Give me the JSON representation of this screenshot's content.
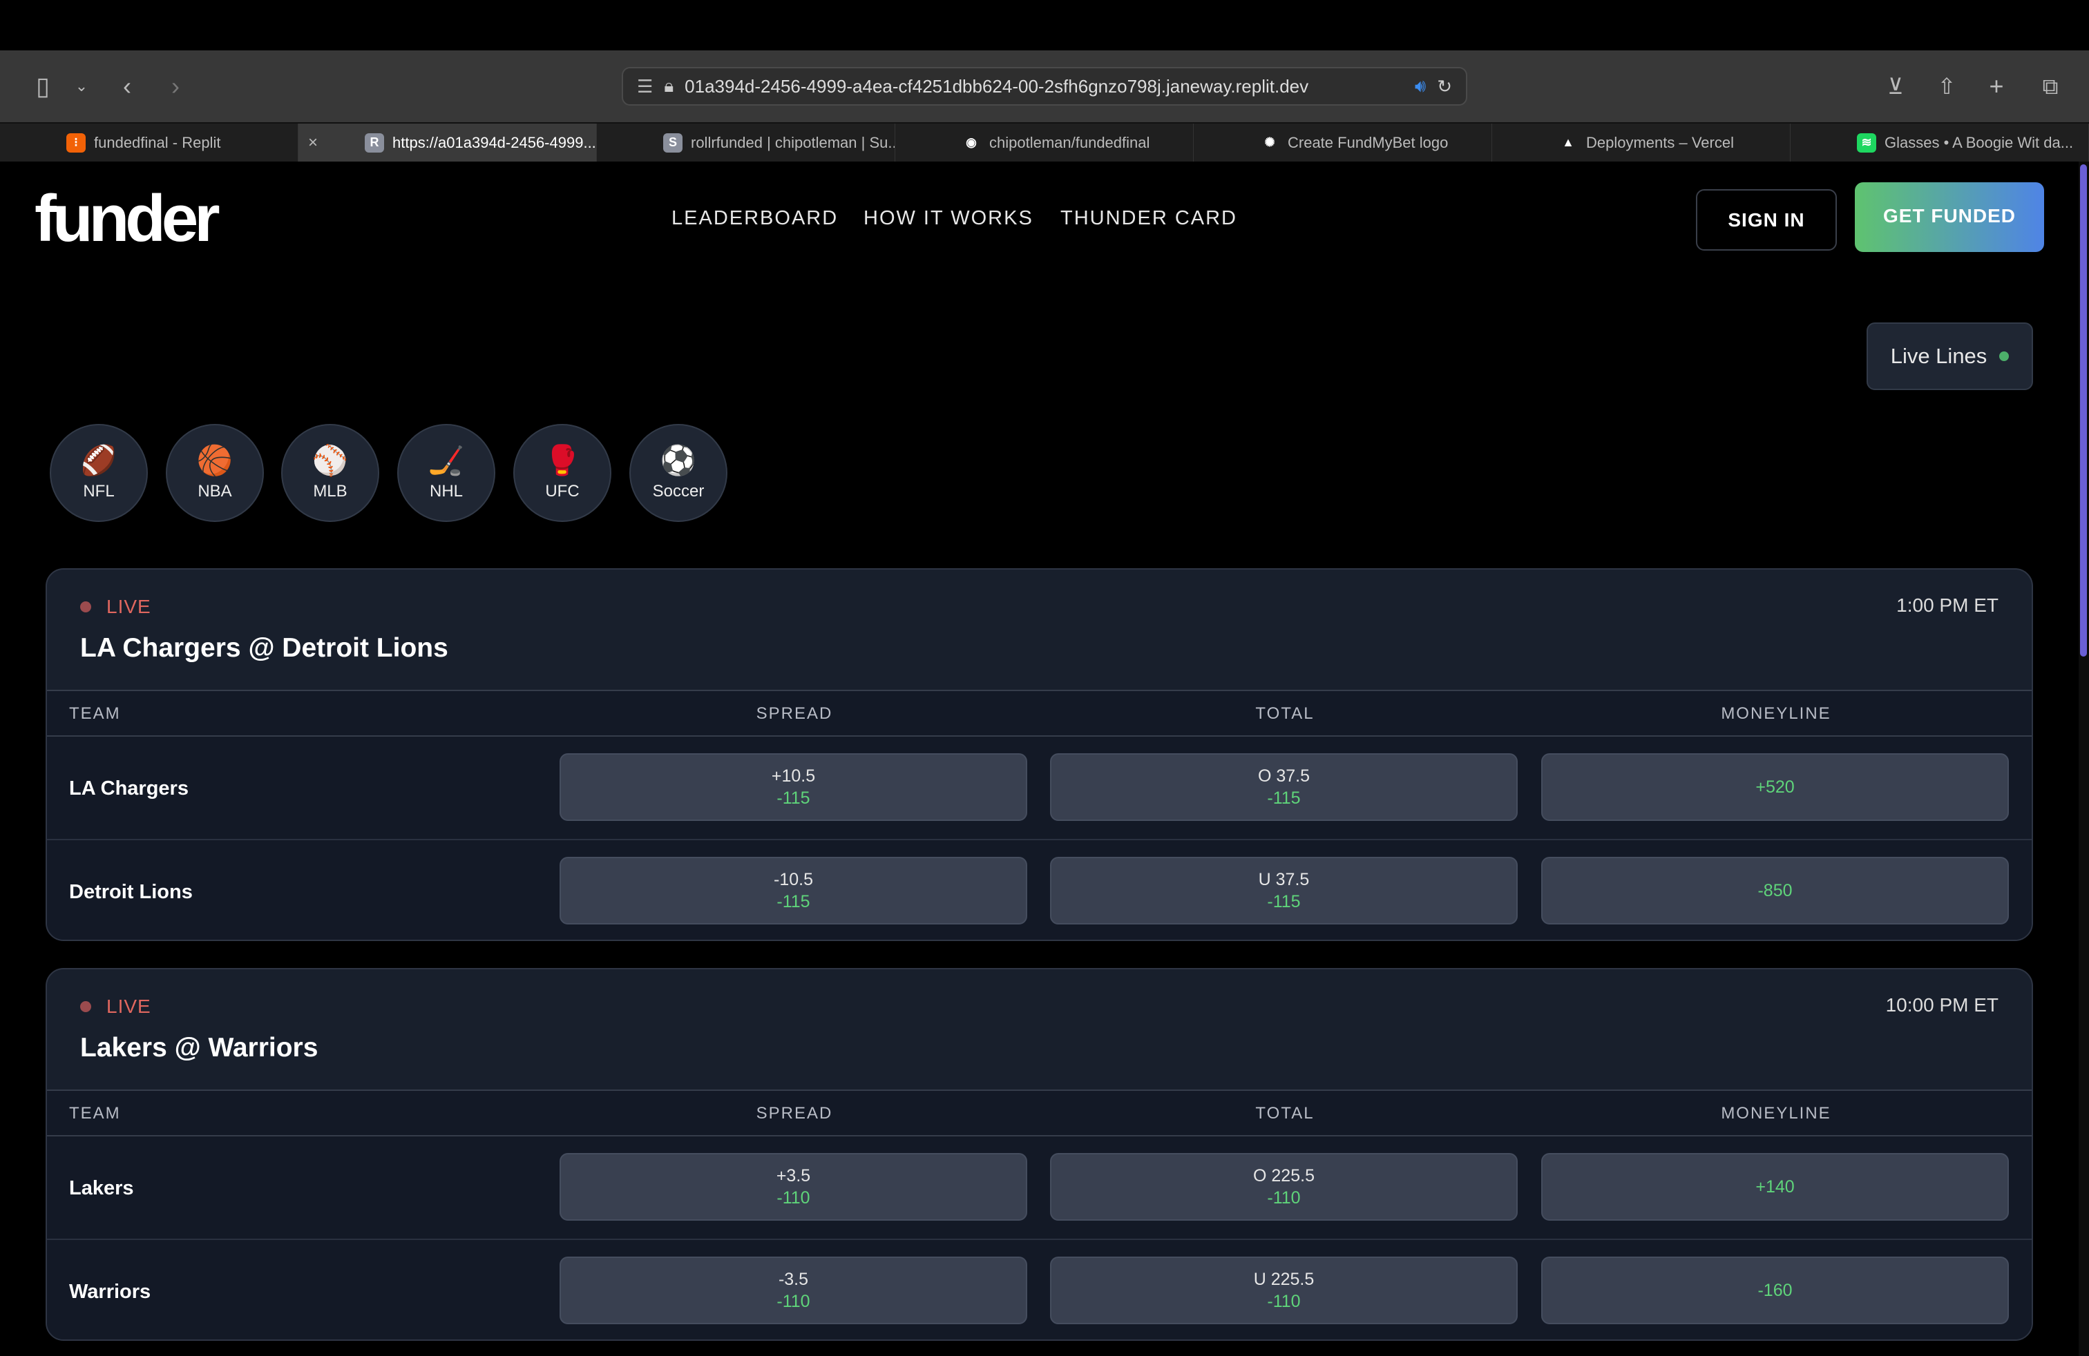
{
  "browser": {
    "url": "01a394d-2456-4999-a4ea-cf4251dbb624-00-2sfh6gnzo798j.janeway.replit.dev",
    "tabs": [
      {
        "label": "fundedfinal - Replit",
        "icon": "replit-icon",
        "fav": "⁝",
        "color": "#f26207"
      },
      {
        "label": "https://a01a394d-2456-4999...",
        "icon": "replit-r-icon",
        "fav": "R",
        "color": "#8a8f9c",
        "active": true
      },
      {
        "label": "rollrfunded | chipotleman | Su...",
        "icon": "s-icon",
        "fav": "S",
        "color": "#8a8f9c"
      },
      {
        "label": "chipotleman/fundedfinal",
        "icon": "github-icon",
        "fav": "◉",
        "color": "#ffffff"
      },
      {
        "label": "Create FundMyBet logo",
        "icon": "openai-icon",
        "fav": "✺",
        "color": "#ffffff"
      },
      {
        "label": "Deployments – Vercel",
        "icon": "vercel-icon",
        "fav": "▲",
        "color": "#ffffff"
      },
      {
        "label": "Glasses • A Boogie Wit da...",
        "icon": "spotify-icon",
        "fav": "≋",
        "color": "#1ed760"
      }
    ]
  },
  "header": {
    "logo": "funder",
    "nav": [
      "LEADERBOARD",
      "HOW IT WORKS",
      "THUNDER CARD"
    ],
    "sign_in": "SIGN IN",
    "get_funded": "GET FUNDED"
  },
  "live_lines": "Live Lines",
  "sports": [
    {
      "label": "NFL",
      "icon": "🏈"
    },
    {
      "label": "NBA",
      "icon": "🏀"
    },
    {
      "label": "MLB",
      "icon": "⚾"
    },
    {
      "label": "NHL",
      "icon": "🏒"
    },
    {
      "label": "UFC",
      "icon": "🥊"
    },
    {
      "label": "Soccer",
      "icon": "⚽"
    }
  ],
  "columns": [
    "TEAM",
    "SPREAD",
    "TOTAL",
    "MONEYLINE"
  ],
  "games": [
    {
      "status": "LIVE",
      "time": "1:00 PM ET",
      "title": "LA Chargers @ Detroit Lions",
      "rows": [
        {
          "team": "LA Chargers",
          "spread": "+10.5",
          "spread_odds": "-115",
          "total": "O 37.5",
          "total_odds": "-115",
          "moneyline": "+520"
        },
        {
          "team": "Detroit Lions",
          "spread": "-10.5",
          "spread_odds": "-115",
          "total": "U 37.5",
          "total_odds": "-115",
          "moneyline": "-850"
        }
      ]
    },
    {
      "status": "LIVE",
      "time": "10:00 PM ET",
      "title": "Lakers @ Warriors",
      "rows": [
        {
          "team": "Lakers",
          "spread": "+3.5",
          "spread_odds": "-110",
          "total": "O 225.5",
          "total_odds": "-110",
          "moneyline": "+140"
        },
        {
          "team": "Warriors",
          "spread": "-3.5",
          "spread_odds": "-110",
          "total": "U 225.5",
          "total_odds": "-110",
          "moneyline": "-160"
        }
      ]
    }
  ],
  "colors": {
    "accent_green": "#5fd47a",
    "live_red": "#e0675f",
    "card_bg": "#181f2c",
    "gradient_start": "#5fc36f",
    "gradient_end": "#4f84e6"
  }
}
